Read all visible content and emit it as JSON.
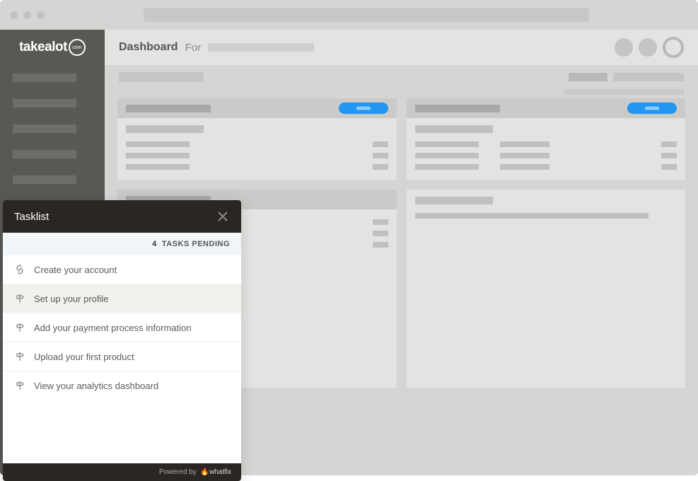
{
  "logo": {
    "text": "takealot",
    "suffix": "com"
  },
  "header": {
    "title": "Dashboard",
    "sub": "For"
  },
  "tasklist": {
    "title": "Tasklist",
    "pending_count": "4",
    "pending_label": "TASKS PENDING",
    "footer_prefix": "Powered by",
    "footer_brand": "whatfix",
    "items": [
      {
        "label": "Create your account",
        "icon": "link"
      },
      {
        "label": "Set up your profile",
        "icon": "signpost",
        "selected": true
      },
      {
        "label": "Add your payment process information",
        "icon": "signpost"
      },
      {
        "label": "Upload your first product",
        "icon": "signpost"
      },
      {
        "label": "View your analytics dashboard",
        "icon": "signpost"
      }
    ]
  }
}
